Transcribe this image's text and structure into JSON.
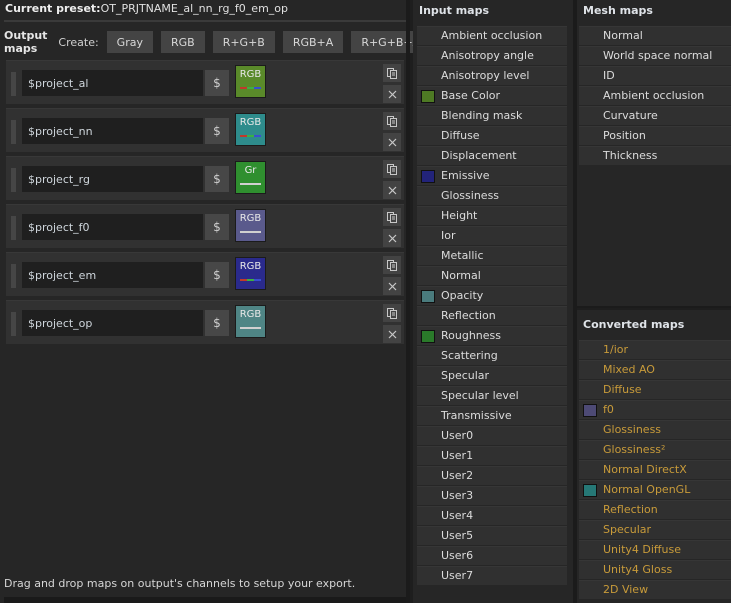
{
  "preset": {
    "label": "Current preset:",
    "value": "OT_PRJTNAME_al_nn_rg_f0_em_op"
  },
  "output_maps": {
    "title": "Output maps",
    "create_label": "Create:",
    "create_buttons": [
      "Gray",
      "RGB",
      "R+G+B",
      "RGB+A",
      "R+G+B+A"
    ],
    "var_button_label": "$",
    "rows": [
      {
        "name": "$project_al",
        "channel": "RGB",
        "color": "#5a8a2a",
        "bar": "rgb"
      },
      {
        "name": "$project_nn",
        "channel": "RGB",
        "color": "#2e8c8c",
        "bar": "rgb"
      },
      {
        "name": "$project_rg",
        "channel": "Gr",
        "color": "#2f8f2f",
        "bar": "gray"
      },
      {
        "name": "$project_f0",
        "channel": "RGB",
        "color": "#5a5a8c",
        "bar": "gray"
      },
      {
        "name": "$project_em",
        "channel": "RGB",
        "color": "#2a2a8c",
        "bar": "rgb"
      },
      {
        "name": "$project_op",
        "channel": "RGB",
        "color": "#4f8585",
        "bar": "gray"
      }
    ],
    "hint": "Drag and drop maps on output's channels to setup your export."
  },
  "input_maps": {
    "title": "Input maps",
    "items": [
      {
        "label": "Ambient occlusion"
      },
      {
        "label": "Anisotropy angle"
      },
      {
        "label": "Anisotropy level"
      },
      {
        "label": "Base Color",
        "color": "#4e7a24"
      },
      {
        "label": "Blending mask"
      },
      {
        "label": "Diffuse"
      },
      {
        "label": "Displacement"
      },
      {
        "label": "Emissive",
        "color": "#22237a"
      },
      {
        "label": "Glossiness"
      },
      {
        "label": "Height"
      },
      {
        "label": "Ior"
      },
      {
        "label": "Metallic"
      },
      {
        "label": "Normal"
      },
      {
        "label": "Opacity",
        "color": "#4a7b7d"
      },
      {
        "label": "Reflection"
      },
      {
        "label": "Roughness",
        "color": "#2a7a2a"
      },
      {
        "label": "Scattering"
      },
      {
        "label": "Specular"
      },
      {
        "label": "Specular level"
      },
      {
        "label": "Transmissive"
      },
      {
        "label": "User0"
      },
      {
        "label": "User1"
      },
      {
        "label": "User2"
      },
      {
        "label": "User3"
      },
      {
        "label": "User4"
      },
      {
        "label": "User5"
      },
      {
        "label": "User6"
      },
      {
        "label": "User7"
      }
    ]
  },
  "mesh_maps": {
    "title": "Mesh maps",
    "items": [
      {
        "label": "Normal"
      },
      {
        "label": "World space normal"
      },
      {
        "label": "ID"
      },
      {
        "label": "Ambient occlusion"
      },
      {
        "label": "Curvature"
      },
      {
        "label": "Position"
      },
      {
        "label": "Thickness"
      }
    ]
  },
  "converted_maps": {
    "title": "Converted maps",
    "items": [
      {
        "label": "1/ior"
      },
      {
        "label": "Mixed AO"
      },
      {
        "label": "Diffuse"
      },
      {
        "label": "f0",
        "color": "#4d4a75"
      },
      {
        "label": "Glossiness"
      },
      {
        "label": "Glossiness²"
      },
      {
        "label": "Normal DirectX"
      },
      {
        "label": "Normal OpenGL",
        "color": "#267876"
      },
      {
        "label": "Reflection"
      },
      {
        "label": "Specular"
      },
      {
        "label": "Unity4 Diffuse"
      },
      {
        "label": "Unity4 Gloss"
      },
      {
        "label": "2D View"
      }
    ]
  },
  "colors": {
    "converted_text": "#c89b3a",
    "rgb_bar": [
      "#c0392b",
      "#3cb043",
      "#3a4fd0"
    ],
    "gray_bar": "#d0d0d0"
  }
}
